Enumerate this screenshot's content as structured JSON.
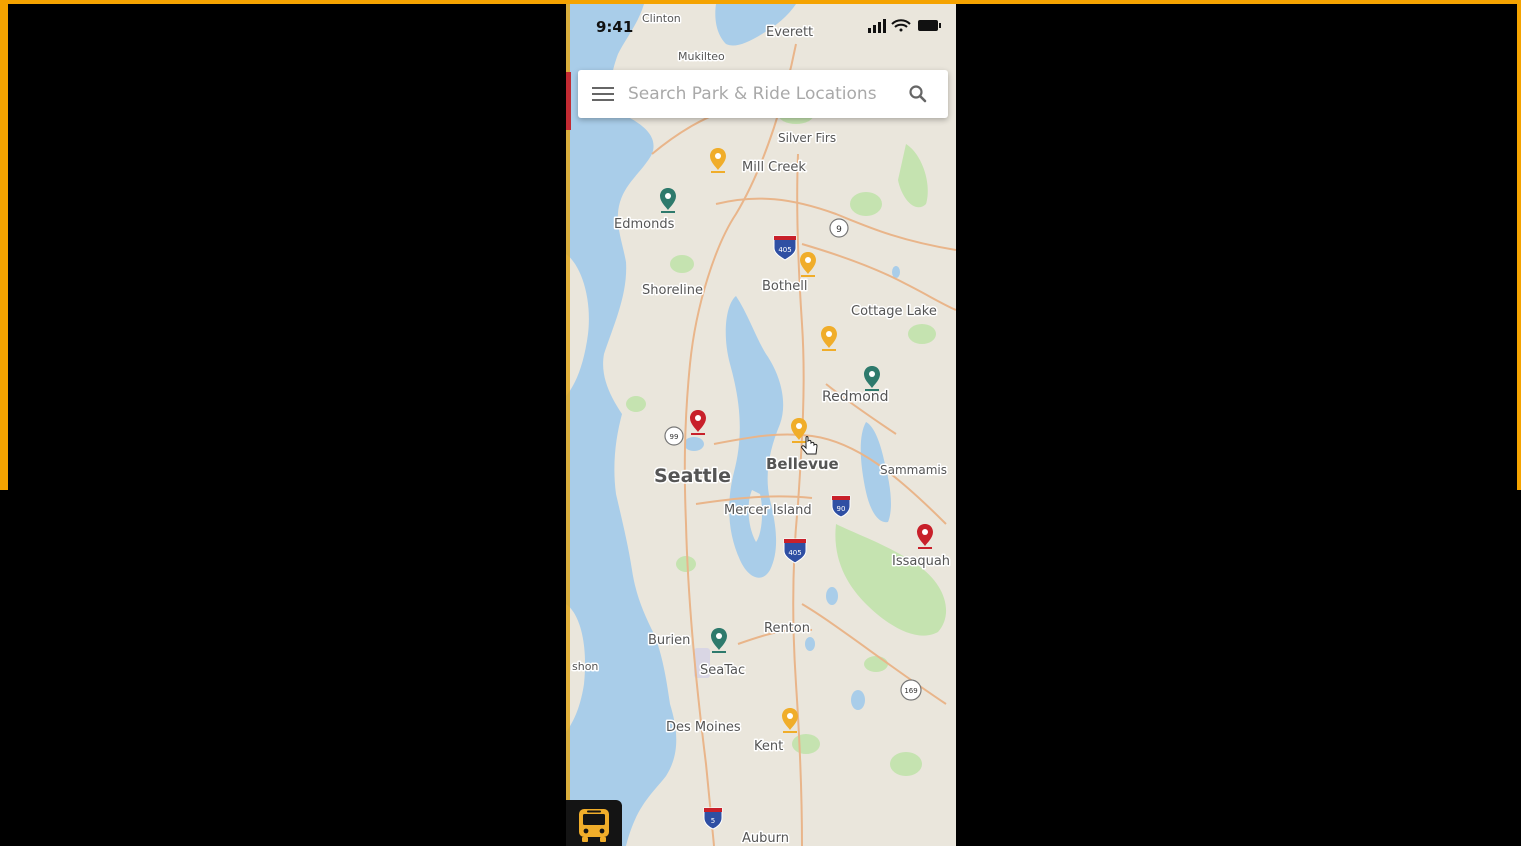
{
  "status_bar": {
    "time": "9:41"
  },
  "search": {
    "placeholder": "Search Park & Ride Locations"
  },
  "map": {
    "colors": {
      "water": "#a9cde9",
      "land": "#eae6dc",
      "park": "#c5e3b0",
      "road": "#e9b58a",
      "marker_orange": "#f0ad2a",
      "marker_teal": "#2e7a6c",
      "marker_red": "#c8202a"
    },
    "labels": {
      "clinton": "Clinton",
      "everett": "Everett",
      "mukilteo": "Mukilteo",
      "silver_firs": "Silver Firs",
      "mill_creek": "Mill Creek",
      "edmonds": "Edmonds",
      "shoreline": "Shoreline",
      "bothell": "Bothell",
      "cottage_lake": "Cottage Lake",
      "redmond": "Redmond",
      "seattle": "Seattle",
      "bellevue": "Bellevue",
      "sammamish": "Sammamis",
      "mercer_island": "Mercer Island",
      "issaquah": "Issaquah",
      "renton": "Renton",
      "burien": "Burien",
      "seatac": "SeaTac",
      "shon": "shon",
      "des_moines": "Des Moines",
      "kent": "Kent",
      "auburn": "Auburn"
    },
    "shields": {
      "route_9": "9",
      "i_405_north": "405",
      "route_99": "99",
      "i_90": "90",
      "i_405_south": "405",
      "route_169": "169",
      "i_5": "5"
    }
  },
  "bus_button_icon": "bus-icon"
}
